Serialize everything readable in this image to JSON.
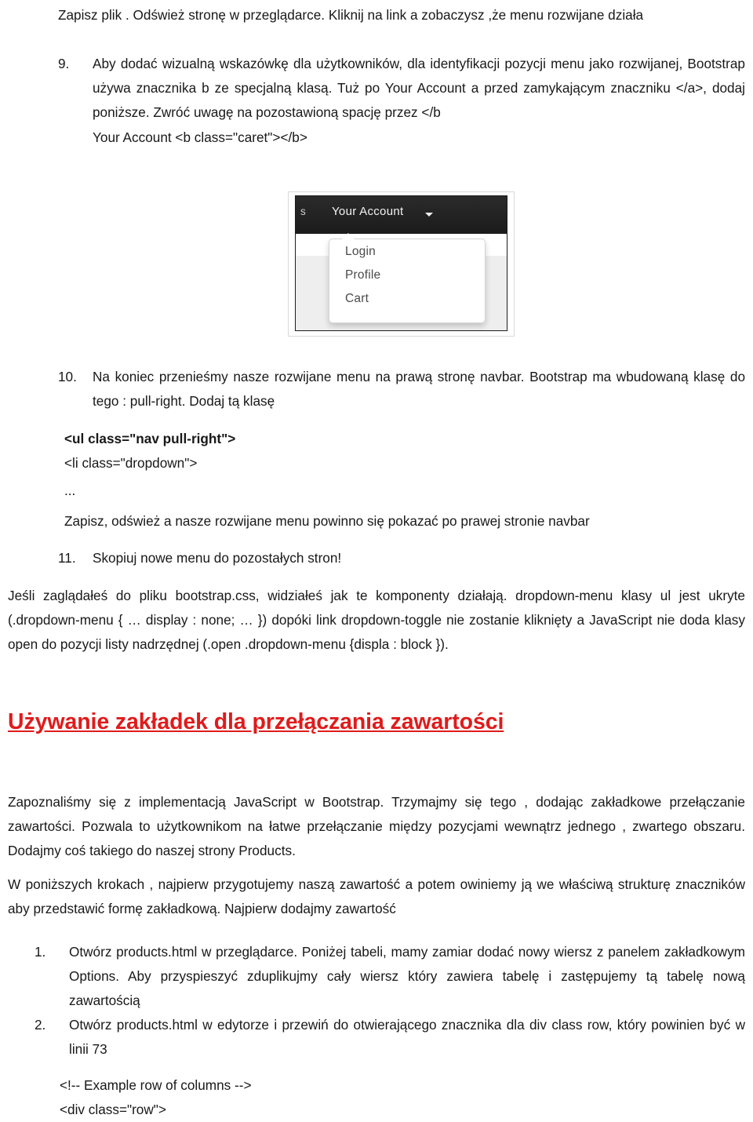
{
  "document": {
    "language": "pl",
    "accent_color": "#E01B1B",
    "text_color": "#181818",
    "background": "#ffffff"
  },
  "blocks": {
    "intro_paragraph": "Zapisz plik . Odśwież stronę w przeglądarce. Kliknij na link a zobaczysz ,że menu rozwijane działa",
    "item9": {
      "number": "9.",
      "text": "Aby dodać wizualną wskazówkę dla użytkowników, dla identyfikacji pozycji menu jako rozwijanej, Bootstrap używa znacznika b ze specjalną klasą. Tuż po Your Account a przed zamykającym znaczniku </a>, dodaj poniższe. Zwróć uwagę na pozostawioną spację przez </b",
      "code_line": "Your Account <b class=\"caret\"></b>"
    },
    "item10": {
      "number": "10.",
      "text": "Na koniec przenieśmy nasze rozwijane menu na prawą stronę navbar. Bootstrap ma wbudowaną klasę do tego : pull-right. Dodaj tą klasę",
      "code_lines": [
        "<ul class=\"nav pull-right\">",
        "<li class=\"dropdown\">",
        "..."
      ],
      "after_code_text": "Zapisz, odśwież a nasze rozwijane menu powinno się pokazać po prawej stronie navbar"
    },
    "item11": {
      "number": "11.",
      "text": "Skopiuj nowe menu do pozostałych stron!"
    },
    "css_explanation": "Jeśli zaglądałeś do pliku bootstrap.css, widziałeś jak te komponenty działają. dropdown-menu klasy ul jest ukryte (.dropdown-menu { … display : none; … }) dopóki link dropdown-toggle nie zostanie kliknięty a JavaScript nie doda klasy open do pozycji listy nadrzędnej (.open   .dropdown-menu {displa : block }).",
    "heading": "Używanie zakładek dla przełączania zawartości",
    "tabs_paragraph_1": "Zapoznaliśmy się  z implementacją JavaScript w Bootstrap. Trzymajmy się tego , dodając zakładkowe przełączanie zawartości. Pozwala to użytkownikom na łatwe przełączanie między pozycjami wewnątrz jednego , zwartego obszaru. Dodajmy coś takiego do naszej strony Products.",
    "tabs_paragraph_2": "W poniższych krokach , najpierw przygotujemy naszą zawartość a potem owiniemy ją we właściwą strukturę znaczników aby przedstawić formę zakładkową. Najpierw dodajmy zawartość",
    "step1": {
      "number": "1.",
      "text": "Otwórz products.html w przeglądarce. Poniżej tabeli, mamy zamiar dodać nowy wiersz z panelem zakładkowym Options. Aby przyspieszyć  zduplikujmy cały wiersz który zawiera tabelę i zastępujemy tą tabelę nową zawartością"
    },
    "step2": {
      "number": "2.",
      "text": "Otwórz products.html w edytorze i przewiń do otwierającego znacznika dla div class row, który powinien być w linii 73"
    },
    "bottom_code_lines": [
      "<!-- Example row of columns -->",
      "<div class=\"row\">"
    ]
  },
  "figure": {
    "alt": "Zrzut ekranu rozwijanego menu Bootstrap",
    "navbar": {
      "truncated_label": "s",
      "account_label": "Your Account",
      "caret_icon": "caret-down-icon",
      "background": "#222222"
    },
    "dropdown": {
      "items": [
        "Login",
        "Profile",
        "Cart"
      ]
    }
  }
}
